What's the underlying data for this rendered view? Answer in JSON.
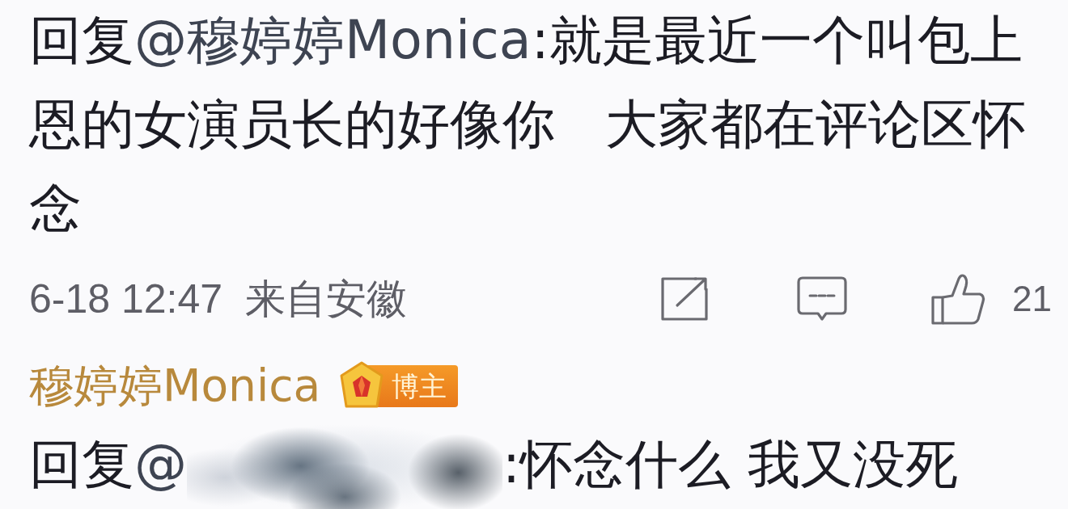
{
  "comments": [
    {
      "reply_prefix": "回复",
      "mention": "@穆婷婷Monica",
      "text": ":就是最近一个叫包上恩的女演员长的好像你   大家都在评论区怀念",
      "time": "6-18 12:47",
      "location": "来自安徽",
      "like_count": "21"
    },
    {
      "author": "穆婷婷Monica",
      "badge": "博主",
      "reply_prefix": "回复",
      "mention": "@",
      "redacted": true,
      "text": ":怀念什么 我又没死"
    }
  ]
}
